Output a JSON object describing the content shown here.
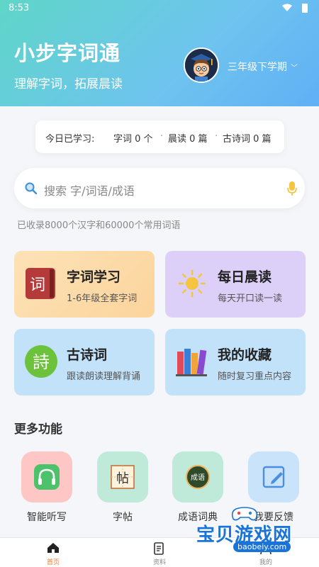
{
  "status": {
    "time": "8:53"
  },
  "header": {
    "title": "小步字词通",
    "subtitle": "理解字词，拓展晨读",
    "grade": "三年级下学期"
  },
  "today": {
    "label": "今日已学习:",
    "words": "字词 0 个",
    "morning": "晨读 0 篇",
    "poems": "古诗词 0 篇"
  },
  "search": {
    "placeholder": "搜索 字/词语/成语",
    "count_text": "已收录8000个汉字和60000个常用词语"
  },
  "cards": [
    {
      "title": "字词学习",
      "subtitle": "1-6年级全套字词",
      "color": "#fcd49c"
    },
    {
      "title": "每日晨读",
      "subtitle": "每天开口读一读",
      "color": "#dccff8"
    },
    {
      "title": "古诗词",
      "subtitle": "跟读朗读理解背诵",
      "color": "#c2e2fa"
    },
    {
      "title": "我的收藏",
      "subtitle": "随时复习重点内容",
      "color": "#c2e2fa"
    }
  ],
  "card_icon_text": {
    "ci": "词",
    "shi": "詩"
  },
  "more": {
    "title": "更多功能",
    "items": [
      {
        "label": "智能听写",
        "icon": "headphones-icon"
      },
      {
        "label": "字帖",
        "icon": "copybook-icon",
        "glyph": "帖"
      },
      {
        "label": "成语词典",
        "icon": "idiom-dictionary-icon",
        "glyph": "成语"
      },
      {
        "label": "我要反馈",
        "icon": "feedback-icon"
      }
    ]
  },
  "tabs": [
    {
      "label": "首页",
      "active": true
    },
    {
      "label": "资料",
      "active": false
    },
    {
      "label": "我的",
      "active": false
    }
  ],
  "watermark": {
    "text": "宝贝游戏网",
    "url": "baobeiy.com"
  },
  "colors": {
    "accent": "#5fc7e0",
    "active_tab": "#f07a2e"
  }
}
